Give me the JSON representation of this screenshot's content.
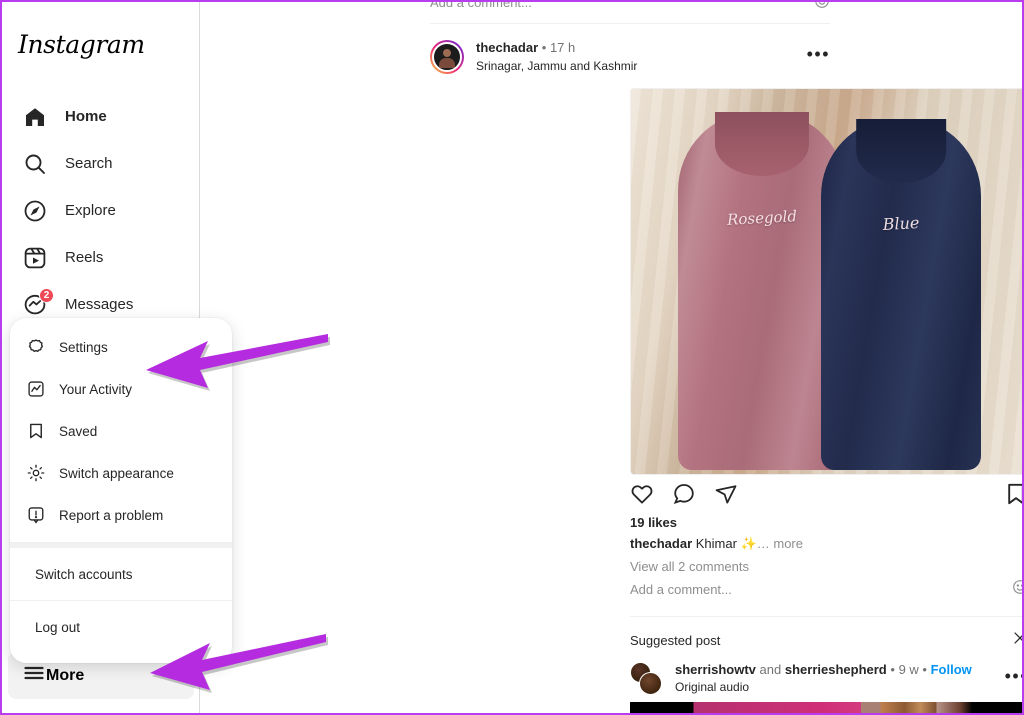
{
  "app": {
    "name": "Instagram",
    "logo_text": "Instagram",
    "accent_purple": "#b83df0",
    "link_blue": "#0095f6",
    "badge_red": "#ed4956"
  },
  "sidebar": {
    "items": [
      {
        "label": "Home",
        "icon": "home-icon",
        "active": true,
        "badge": null
      },
      {
        "label": "Search",
        "icon": "search-icon",
        "active": false,
        "badge": null
      },
      {
        "label": "Explore",
        "icon": "compass-icon",
        "active": false,
        "badge": null
      },
      {
        "label": "Reels",
        "icon": "reels-icon",
        "active": false,
        "badge": null
      },
      {
        "label": "Messages",
        "icon": "messenger-icon",
        "active": false,
        "badge": "2"
      }
    ],
    "more_label": "More",
    "more_icon": "hamburger-icon"
  },
  "more_menu": {
    "items": [
      {
        "label": "Settings",
        "icon": "gear-icon"
      },
      {
        "label": "Your Activity",
        "icon": "activity-icon"
      },
      {
        "label": "Saved",
        "icon": "bookmark-icon"
      },
      {
        "label": "Switch appearance",
        "icon": "sun-icon"
      },
      {
        "label": "Report a problem",
        "icon": "report-icon"
      }
    ],
    "switch_accounts": "Switch accounts",
    "log_out": "Log out"
  },
  "previous_post": {
    "add_comment_placeholder": "Add a comment...",
    "emoji_icon": "emoji-icon"
  },
  "post": {
    "username": "thechadar",
    "separator": "•",
    "time": "17 h",
    "location": "Srinagar, Jammu and Kashmir",
    "options_icon": "more-options-icon",
    "image": {
      "alt": "Two khimar abayas hanging side by side",
      "garments": [
        {
          "script_label": "Rosegold",
          "color": "#b3727f"
        },
        {
          "script_label": "Blue",
          "color": "#222b4c"
        }
      ],
      "background_color": "#e4d6c4"
    },
    "actions": {
      "like_icon": "heart-icon",
      "comment_icon": "comment-icon",
      "share_icon": "share-icon",
      "save_icon": "bookmark-icon"
    },
    "likes": "19 likes",
    "caption_user": "thechadar",
    "caption_text": "Khimar ✨",
    "caption_ellipsis": "…",
    "caption_more": "more",
    "view_comments": "View all 2 comments",
    "add_comment_placeholder": "Add a comment...",
    "emoji_icon": "emoji-icon"
  },
  "suggested": {
    "title": "Suggested post",
    "close_icon": "close-icon",
    "account_1": "sherrishowtv",
    "conjunction": "and",
    "account_2": "sherrieshepherd",
    "separator": "•",
    "time": "9 w",
    "follow_label": "Follow",
    "audio": "Original audio",
    "options_icon": "more-options-icon"
  },
  "annotations": {
    "arrow_1": {
      "name": "arrow-pointing-to-your-activity",
      "color": "#b52be0"
    },
    "arrow_2": {
      "name": "arrow-pointing-to-more-button",
      "color": "#b52be0"
    }
  }
}
